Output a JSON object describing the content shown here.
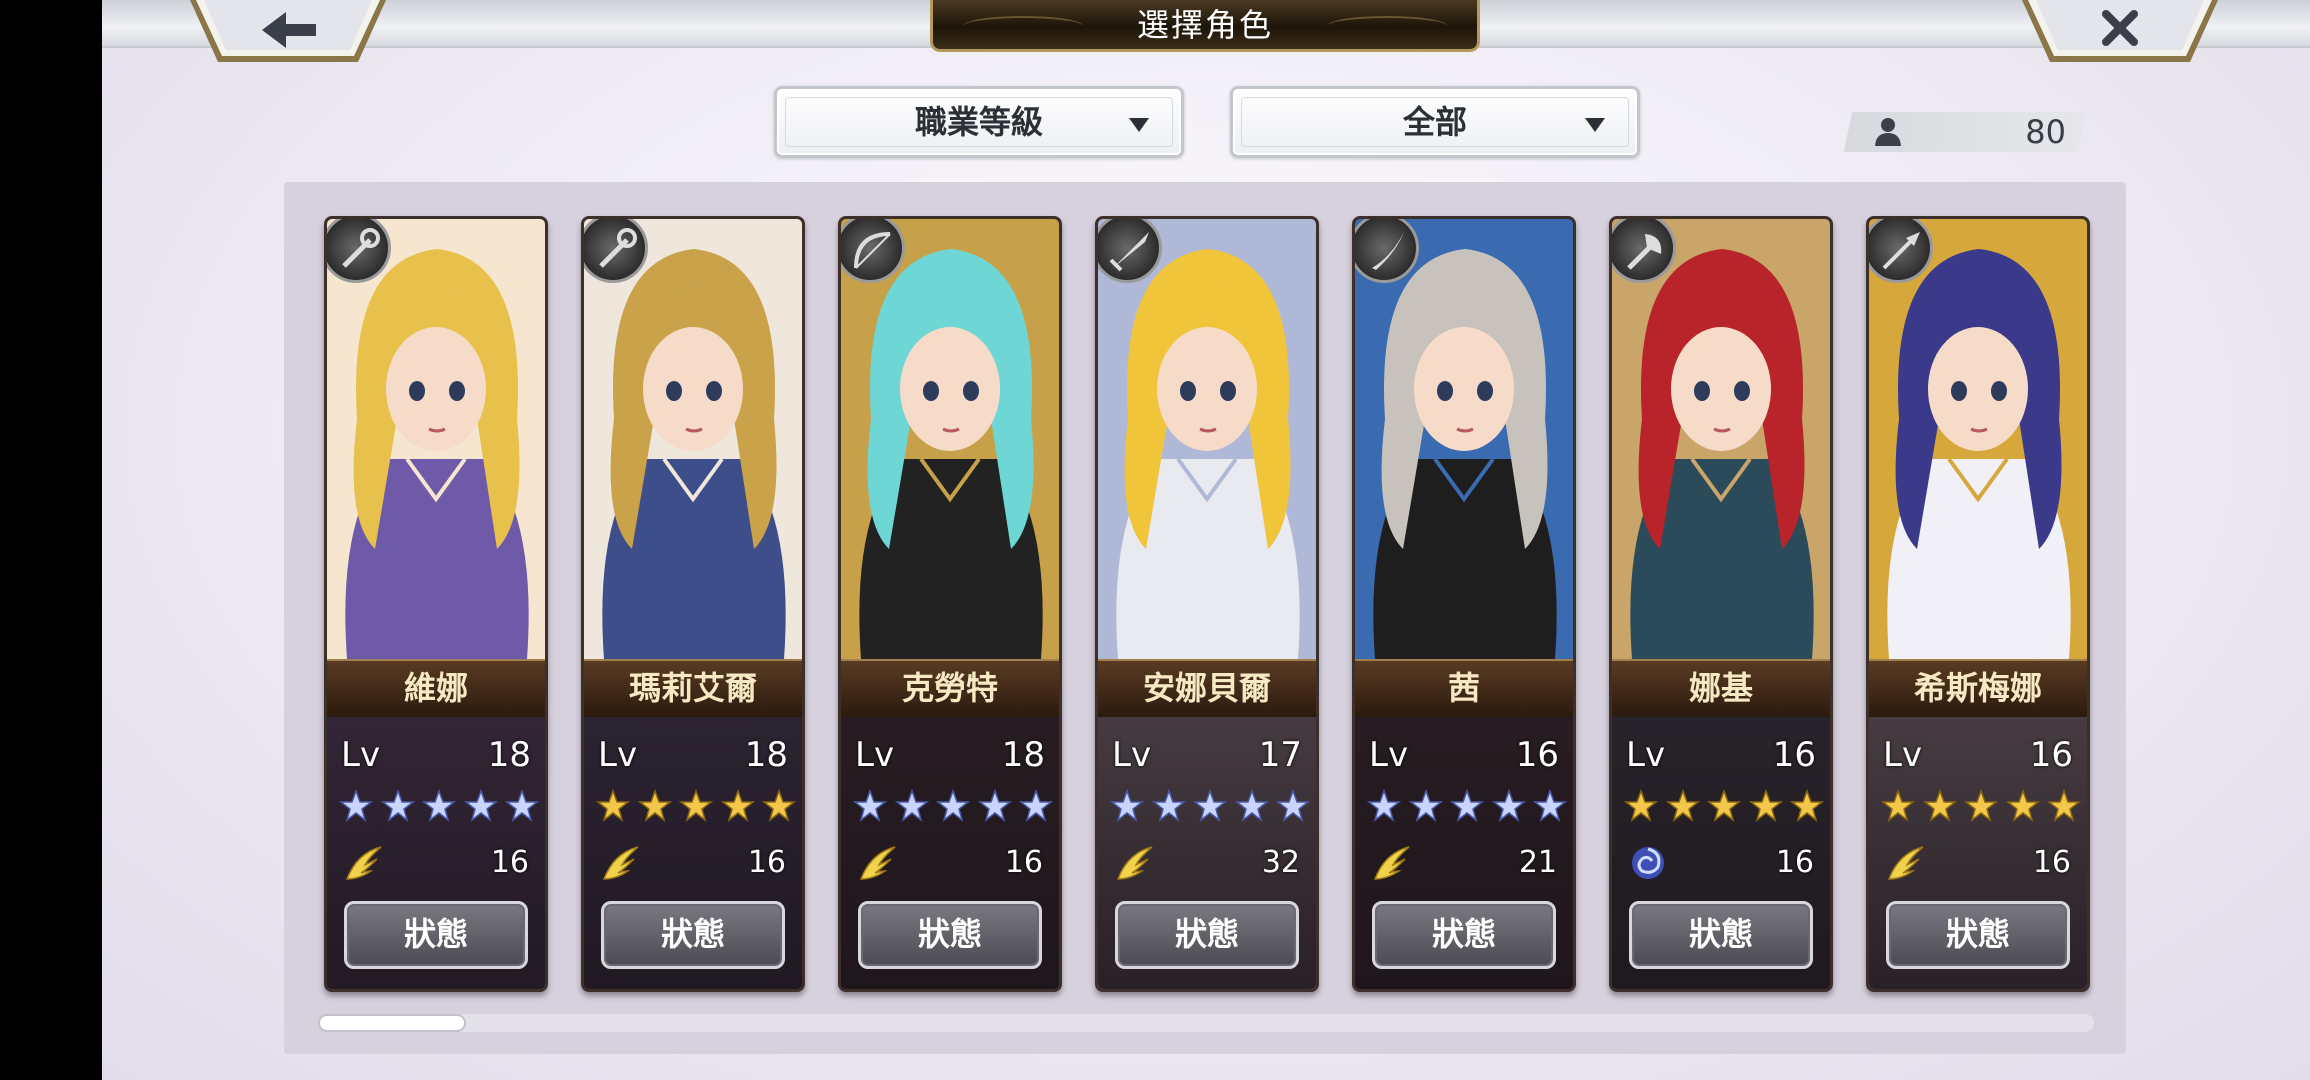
{
  "header": {
    "title": "選擇角色",
    "back_icon": "arrow-left-icon",
    "close_icon": "close-x-icon"
  },
  "filters": {
    "sort": {
      "label": "職業等級"
    },
    "category": {
      "label": "全部"
    }
  },
  "unit_count": {
    "icon": "person-icon",
    "value": "80"
  },
  "ui": {
    "level_label": "Lv",
    "status_label": "狀態"
  },
  "colors": {
    "silver_star": "#c9d4ff",
    "gold_star": "#f3c84a",
    "name_plate": "#3e2816",
    "panel": "#d6d1dd"
  },
  "characters": [
    {
      "name": "維娜",
      "level": "18",
      "stars": 5,
      "star_color": "silver",
      "element_icon": "wind-wing-icon",
      "power": "16",
      "class_icon": "staff-icon",
      "palette": [
        "#e8c14d",
        "#6e5aa8",
        "#f6e6d0"
      ]
    },
    {
      "name": "瑪莉艾爾",
      "level": "18",
      "stars": 5,
      "star_color": "gold",
      "element_icon": "wind-wing-icon",
      "power": "16",
      "class_icon": "staff-icon",
      "palette": [
        "#c9a24a",
        "#3d4e8a",
        "#efe7dc"
      ]
    },
    {
      "name": "克勞特",
      "level": "18",
      "stars": 5,
      "star_color": "silver",
      "element_icon": "wind-wing-icon",
      "power": "16",
      "class_icon": "bow-icon",
      "palette": [
        "#6fd6d6",
        "#222222",
        "#c7a14a"
      ]
    },
    {
      "name": "安娜貝爾",
      "level": "17",
      "stars": 5,
      "star_color": "silver",
      "element_icon": "wind-wing-icon",
      "power": "32",
      "class_icon": "sword-icon",
      "palette": [
        "#f0c53a",
        "#e9e9f0",
        "#b0b8d8"
      ]
    },
    {
      "name": "茜",
      "level": "16",
      "stars": 5,
      "star_color": "silver",
      "element_icon": "wind-wing-icon",
      "power": "21",
      "class_icon": "blade-icon",
      "palette": [
        "#c8c2bd",
        "#1e1e1e",
        "#3a6ab0"
      ]
    },
    {
      "name": "娜基",
      "level": "16",
      "stars": 5,
      "star_color": "gold",
      "element_icon": "water-swirl-icon",
      "power": "16",
      "class_icon": "axe-icon",
      "palette": [
        "#b8242a",
        "#2b4a5a",
        "#c9a56a"
      ]
    },
    {
      "name": "希斯梅娜",
      "level": "16",
      "stars": 5,
      "star_color": "gold",
      "element_icon": "wind-wing-icon",
      "power": "16",
      "class_icon": "spear-icon",
      "palette": [
        "#3b3a8a",
        "#f0f0f6",
        "#d6a83c"
      ]
    }
  ],
  "scroll": {
    "position": 0.0
  }
}
